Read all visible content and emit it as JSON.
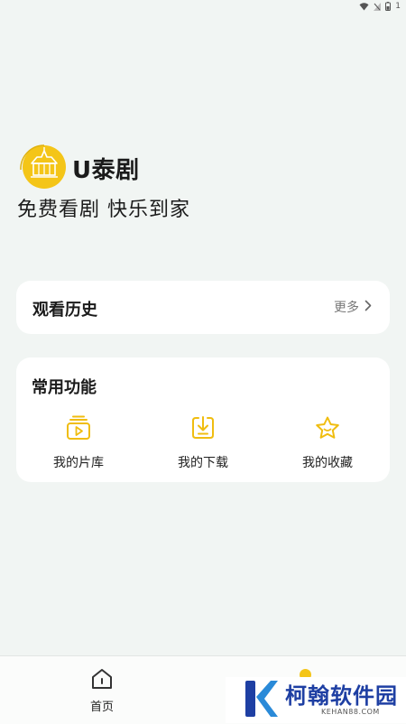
{
  "status_bar": {
    "battery_level": "1"
  },
  "header": {
    "app_name": "U泰剧",
    "slogan": "免费看剧 快乐到家"
  },
  "history": {
    "title": "观看历史",
    "more_label": "更多"
  },
  "functions": {
    "title": "常用功能",
    "items": [
      {
        "label": "我的片库",
        "icon": "video-library-icon"
      },
      {
        "label": "我的下载",
        "icon": "download-icon"
      },
      {
        "label": "我的收藏",
        "icon": "star-icon"
      }
    ]
  },
  "tab_bar": {
    "home_label": "首页"
  },
  "watermark": {
    "name": "柯翰软件园",
    "domain": "KEHAN88.COM"
  },
  "colors": {
    "accent": "#F4C518",
    "background": "#F1F5F3",
    "watermark_blue": "#1E3FA3"
  }
}
